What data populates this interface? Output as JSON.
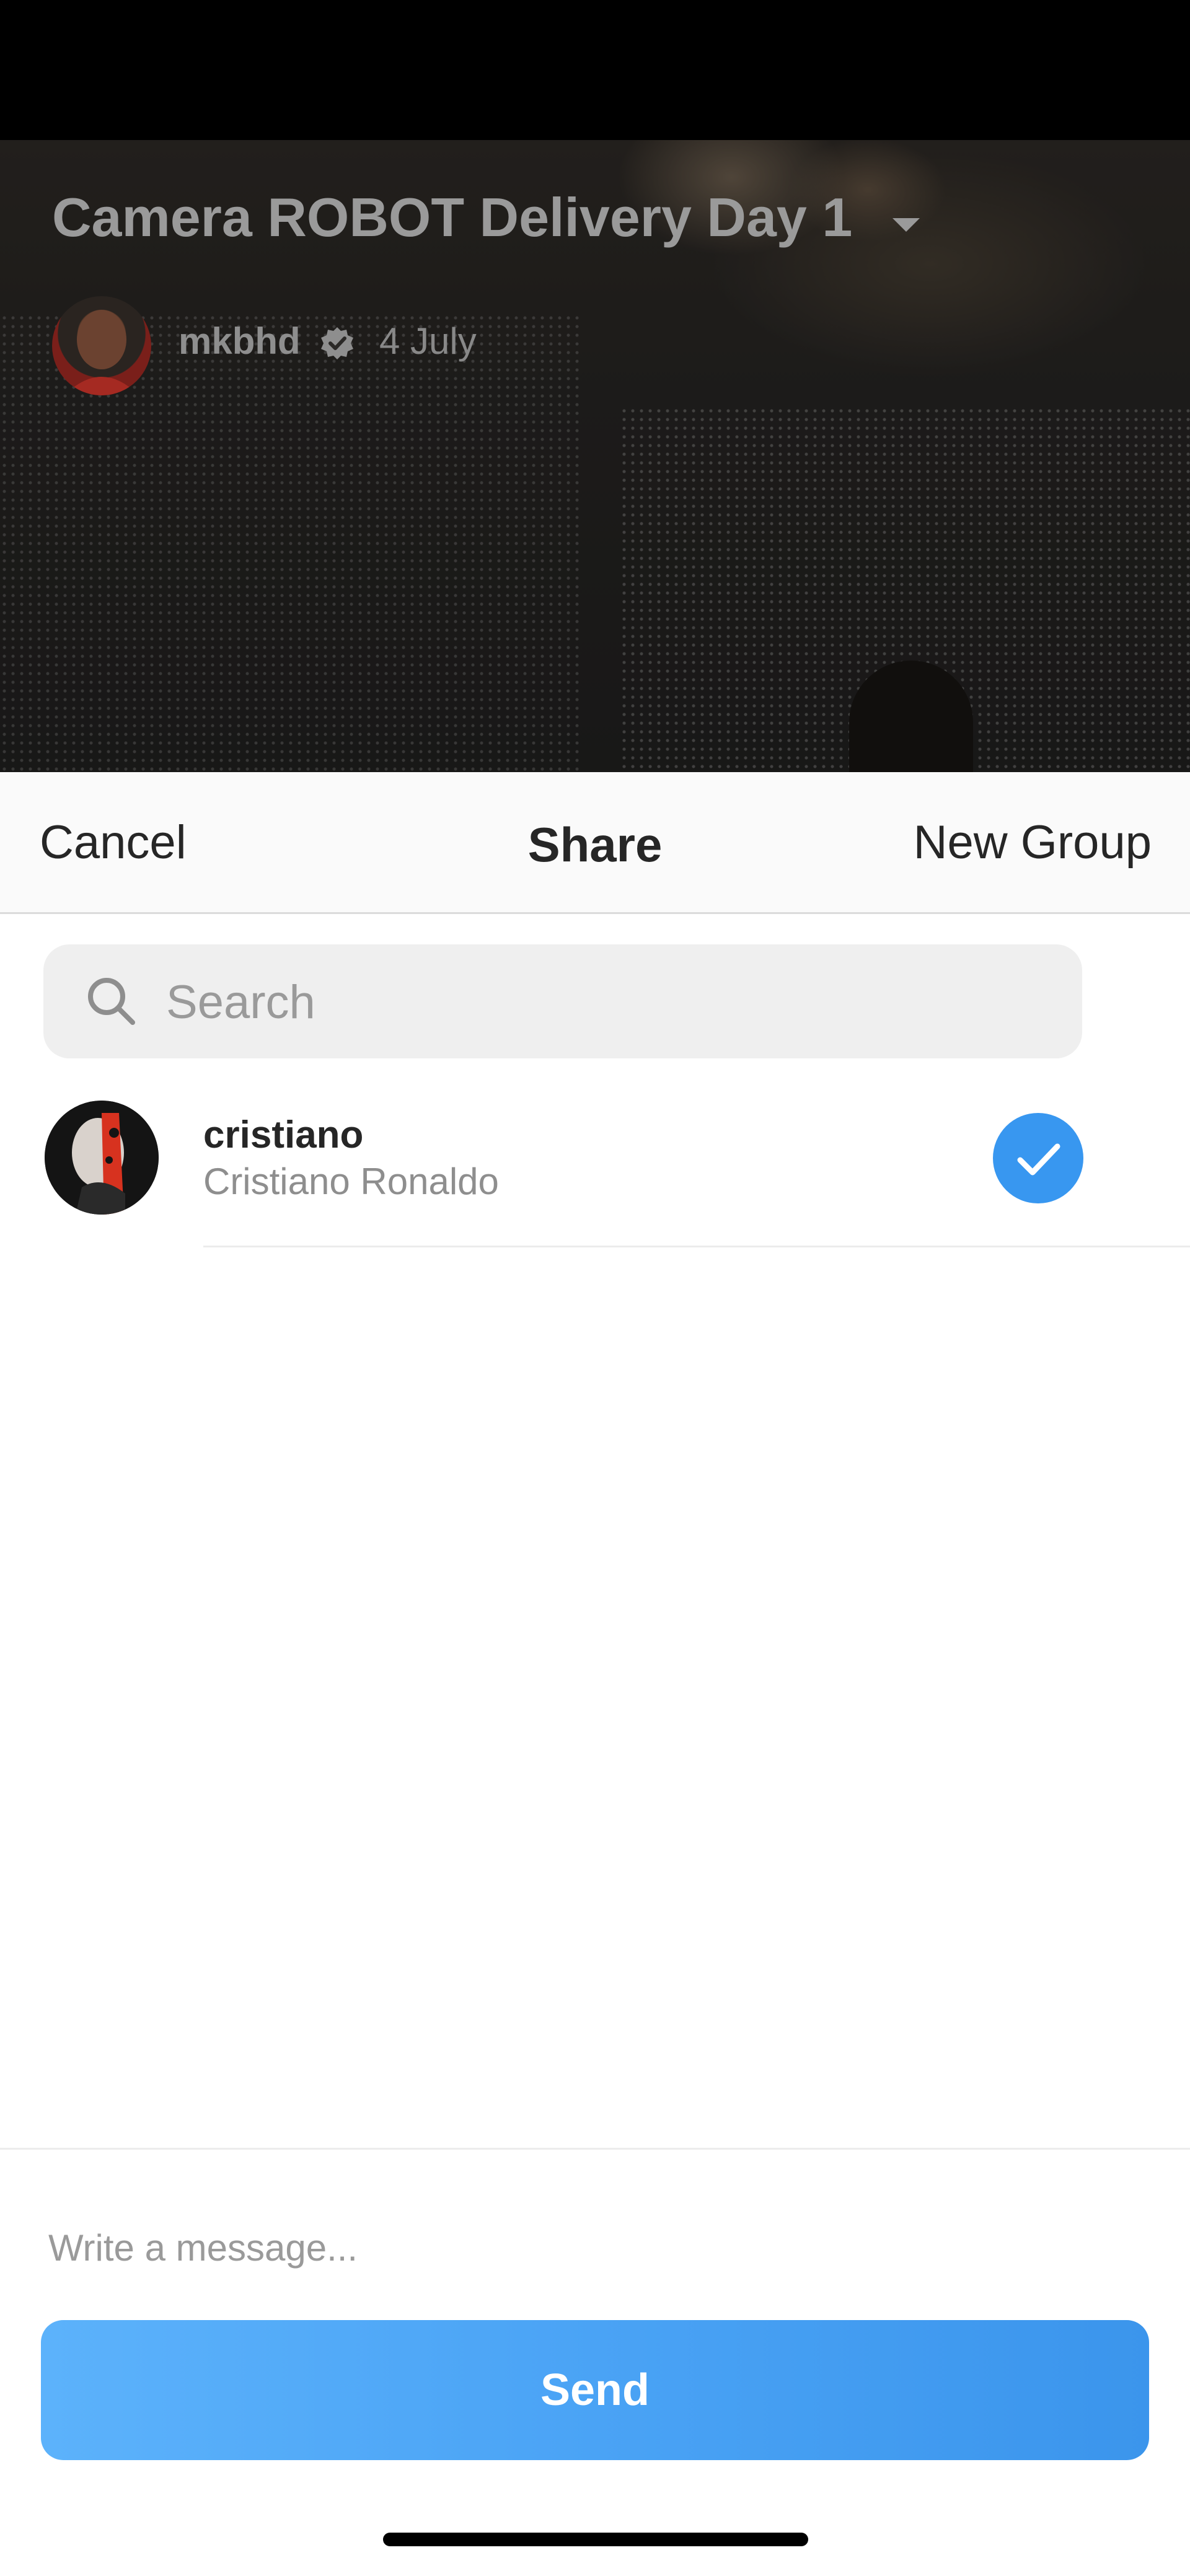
{
  "video": {
    "title": "Camera ROBOT Delivery Day 1",
    "author": "mkbhd",
    "date": "4 July",
    "icons": {
      "dropdown": "chevron-down-icon",
      "verified": "verified-badge-icon"
    }
  },
  "share_sheet": {
    "cancel_label": "Cancel",
    "title": "Share",
    "new_group_label": "New Group",
    "search": {
      "placeholder": "Search",
      "value": ""
    },
    "contacts": [
      {
        "username": "cristiano",
        "full_name": "Cristiano Ronaldo",
        "selected": true
      }
    ],
    "message": {
      "placeholder": "Write a message...",
      "value": ""
    },
    "send_label": "Send"
  },
  "colors": {
    "accent": "#3897f0",
    "send_gradient_start": "#5cb2fb",
    "send_gradient_end": "#3b95ec",
    "text_primary": "#262626",
    "text_secondary": "#8e8e8e"
  }
}
